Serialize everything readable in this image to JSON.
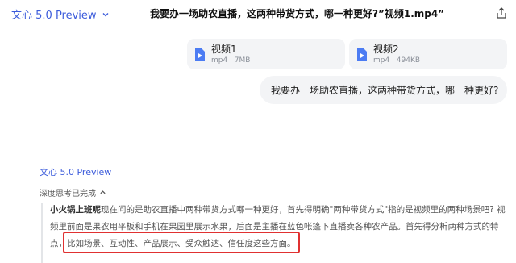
{
  "header": {
    "model_name": "文心 5.0 Preview",
    "chat_title": "我要办一场助农直播，这两种带货方式，哪一种更好?”视频1.mp4”"
  },
  "attachments": [
    {
      "name": "视频1",
      "meta": "mp4 · 7MB"
    },
    {
      "name": "视频2",
      "meta": "mp4 · 494KB"
    }
  ],
  "user_message": "我要办一场助农直播，这两种带货方式，哪一种更好?",
  "answer": {
    "model_name": "文心 5.0 Preview",
    "thinking_label": "深度思考已完成",
    "thinking_user": "小火锅上班呢",
    "thinking_line1_rest": "现在问的是助农直播中两种带货方式哪一种更好，首先得明确\"两种带货方式\"指的是视频里的两种场景吧? 视",
    "thinking_line2": "频里前面是果农用平板和手机在果园里展示水果，后面是主播在蓝色帐篷下直播卖各种农产品。首先得分析两种方式的特",
    "thinking_line3": "点，比如场景、互动性、产品展示、受众触达、信任度这些方面。"
  },
  "colors": {
    "accent": "#3b5bdb",
    "highlight": "#e03131",
    "file_icon": "#4c7cf3"
  }
}
